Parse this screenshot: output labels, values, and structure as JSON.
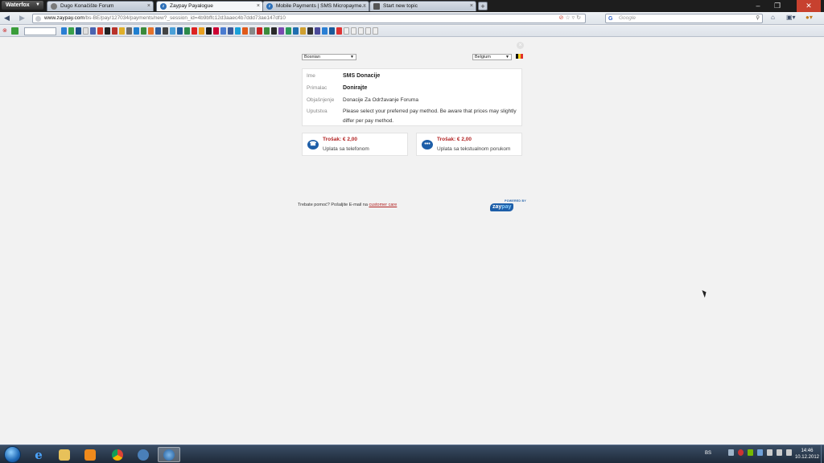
{
  "browser": {
    "app_menu": "Waterfox",
    "tabs": [
      {
        "title": "Dugo Konačište Forum",
        "active": false
      },
      {
        "title": "Zaypay Payalogue",
        "active": true
      },
      {
        "title": "Mobile Payments | SMS Micropayme...",
        "active": false
      },
      {
        "title": "Start new topic",
        "active": false
      }
    ],
    "url_host": "www.zaypay.com",
    "url_path": "/bs-BE/pay/127034/payments/new?_session_id=4b9bffc12d3aaec4b7ddd73ae147df10",
    "search_placeholder": "Google"
  },
  "page": {
    "language_select": "Bosnian",
    "country_select": "Belgium",
    "details": {
      "name_label": "Ime",
      "name_value": "SMS Donacije",
      "recipient_label": "Primalac",
      "recipient_value": "Donirajte",
      "explanation_label": "Objašnjenje",
      "explanation_value": "Donacije Za Održavanje Foruma",
      "instructions_label": "Uputstva",
      "instructions_value": "Please select your preferred pay method. Be aware that prices may slightly differ per pay method."
    },
    "pay_methods": [
      {
        "price": "Trošak: € 2,00",
        "description": "Uplata sa telefonom",
        "icon": "phone-icon"
      },
      {
        "price": "Trošak: € 2,00",
        "description": "Uplata sa tekstualnom porukom",
        "icon": "sms-bubble-icon"
      }
    ],
    "footer_help_text": "Trebate pomoć? Pošaljite E-mail na",
    "footer_link": "customer care",
    "logo_powered": "POWERED BY",
    "logo_text_a": "zay",
    "logo_text_b": "pay"
  },
  "taskbar": {
    "language": "BS",
    "time": "14:46",
    "date": "10.12.2012"
  }
}
